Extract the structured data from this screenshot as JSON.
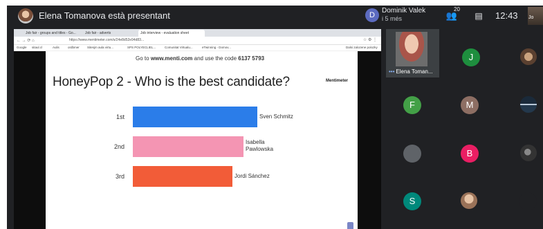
{
  "topbar": {
    "presenting_title": "Elena Tomanova està presentant",
    "peer": {
      "initial": "D",
      "name": "Dominik Valek",
      "time": "i 5 més"
    },
    "people_count": "20",
    "clock": "12:43",
    "self_label": "Jo"
  },
  "browser": {
    "tabs": [
      "Job fair - groups and titles - Go...",
      "Job fair - adverts",
      "Job interview - evaluation sheet"
    ],
    "url": "https://www.mentimeter.com/s/24e8d52e94d83...",
    "bookmarks": [
      "Google",
      "sitaul.cl",
      "Aulis",
      "ordbmer",
      "Sitesjm aula virtu...",
      "SPS POLYECLIEL...",
      "Comunitat Virtualu...",
      "eTwinning - Domov...",
      "Dalsi zalozene polozky"
    ]
  },
  "slide": {
    "code_prefix": "Go to",
    "code_site": "www.menti.com",
    "code_middle": "and use the code",
    "code_value": "6137 5793",
    "title": "HoneyPop 2 - Who is the best candidate?",
    "logo": "Mentimeter",
    "ranking": [
      {
        "rank": "1st",
        "name_line1": "Sven Schmitz",
        "name_line2": "",
        "color": "#2b7de9",
        "value": 1.0
      },
      {
        "rank": "2nd",
        "name_line1": "Isabella",
        "name_line2": "Pawlowska",
        "color": "#f495b3",
        "value": 0.89
      },
      {
        "rank": "3rd",
        "name_line1": "Jordi Sánchez",
        "name_line2": "",
        "color": "#f25c38",
        "value": 0.8
      }
    ]
  },
  "participants": {
    "self_tile_name": "Elena Toman...",
    "tiles": [
      {
        "initial": "J",
        "color": "#1e8e3e"
      },
      {
        "initial": "F",
        "color": "#43a047"
      },
      {
        "initial": "M",
        "color": "#8d6e63"
      },
      {
        "initial": "",
        "color": "#5f6368"
      },
      {
        "initial": "B",
        "color": "#e91e63"
      },
      {
        "initial": "S",
        "color": "#00897b"
      },
      {
        "initial": "",
        "color": "#202124"
      }
    ]
  }
}
